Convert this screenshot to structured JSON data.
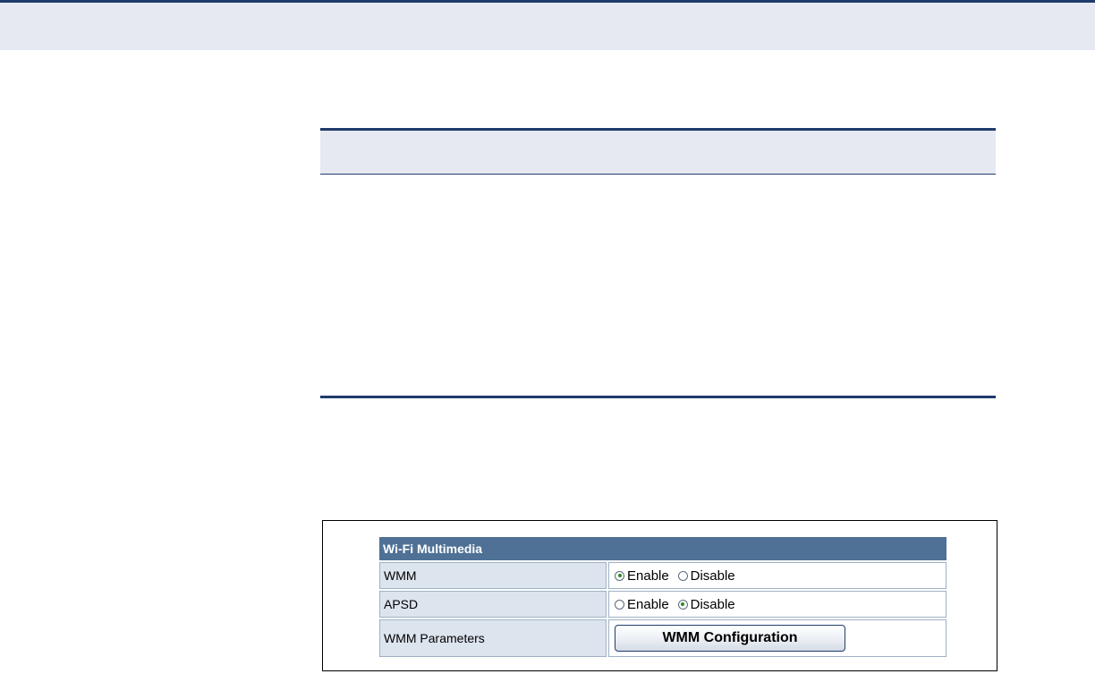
{
  "wifi_multimedia": {
    "title": "Wi-Fi Multimedia",
    "rows": [
      {
        "label": "WMM",
        "options": [
          "Enable",
          "Disable"
        ],
        "selected": "Enable"
      },
      {
        "label": "APSD",
        "options": [
          "Enable",
          "Disable"
        ],
        "selected": "Disable"
      },
      {
        "label": "WMM Parameters",
        "button_label": "WMM Configuration"
      }
    ]
  }
}
